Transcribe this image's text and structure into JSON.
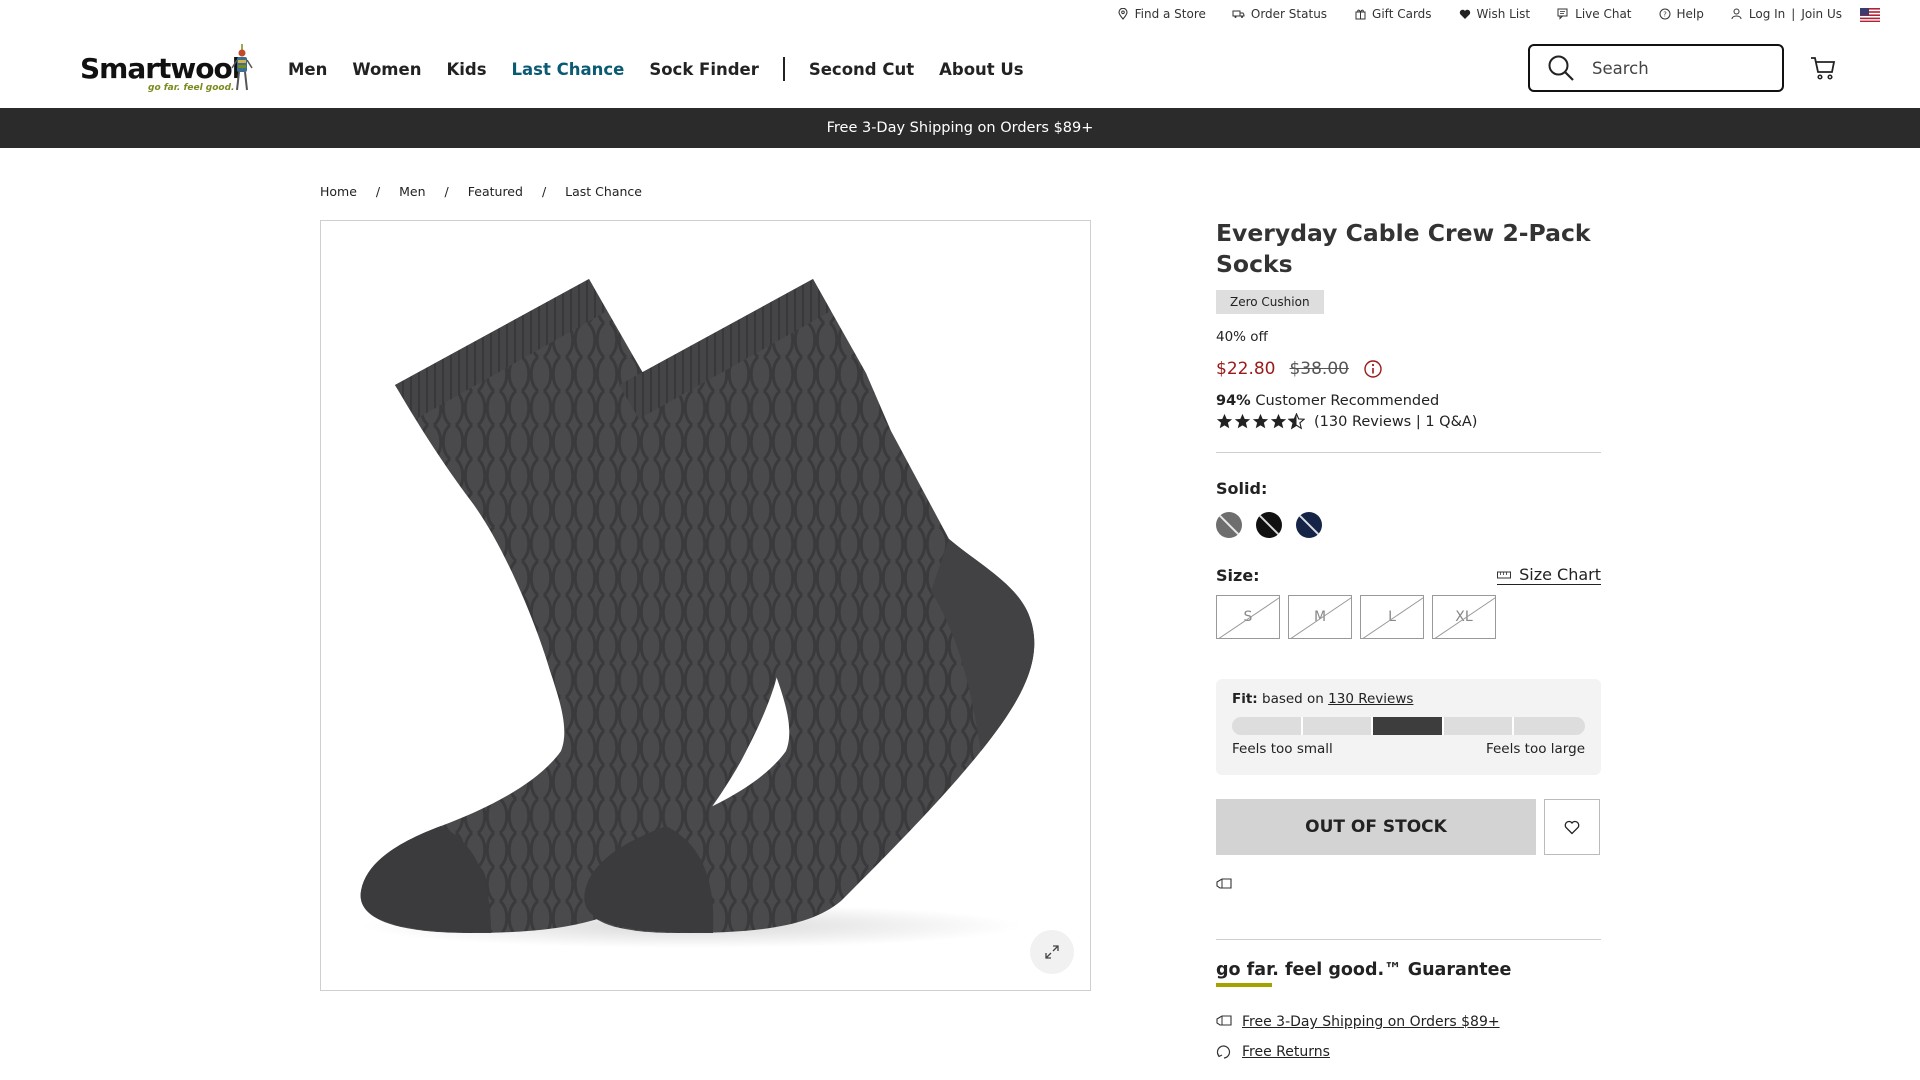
{
  "utility": {
    "links": [
      "Find a Store",
      "Order Status",
      "Gift Cards",
      "Wish List",
      "Live Chat",
      "Help",
      "Log In",
      "Join Us"
    ]
  },
  "header": {
    "logo_text": "Smartwool",
    "logo_tagline": "go far. feel good.",
    "nav": [
      "Men",
      "Women",
      "Kids",
      "Last Chance",
      "Sock Finder",
      "Second Cut",
      "About Us"
    ],
    "active_nav": "Last Chance",
    "search_placeholder": "Search"
  },
  "promo_banner": "Free 3-Day Shipping on Orders $89+",
  "breadcrumb": [
    "Home",
    "Men",
    "Featured",
    "Last Chance"
  ],
  "product": {
    "title": "Everyday Cable Crew 2-Pack Socks",
    "cushion": "Zero Cushion",
    "discount": "40% off",
    "price_sale": "$22.80",
    "price_original": "$38.00",
    "recommended_pct": "94%",
    "recommended_text": "Customer Recommended",
    "rating": 4.5,
    "reviews_text": "(130 Reviews | 1 Q&A)",
    "solid_label": "Solid:",
    "swatches": [
      {
        "name": "gray",
        "color": "#6e6e6e"
      },
      {
        "name": "black",
        "color": "#111111"
      },
      {
        "name": "navy",
        "color": "#152447"
      }
    ],
    "size_label": "Size:",
    "size_chart": "Size Chart",
    "sizes": [
      "S",
      "M",
      "L",
      "XL"
    ],
    "fit": {
      "label": "Fit:",
      "based_on": "based on",
      "reviews_link": "130 Reviews",
      "segments": 5,
      "selected_segment": 3,
      "left_label": "Feels too small",
      "right_label": "Feels too large"
    },
    "cta": "OUT OF STOCK"
  },
  "guarantee": {
    "title": "go far. feel good.™ Guarantee",
    "accent_color": "#a3a300",
    "links": [
      "Free 3-Day Shipping on Orders $89+",
      "Free Returns"
    ]
  },
  "colors": {
    "sale_price": "#9a1a1a",
    "active_nav": "#0b5a73",
    "banner_bg": "#2b2b2b"
  }
}
